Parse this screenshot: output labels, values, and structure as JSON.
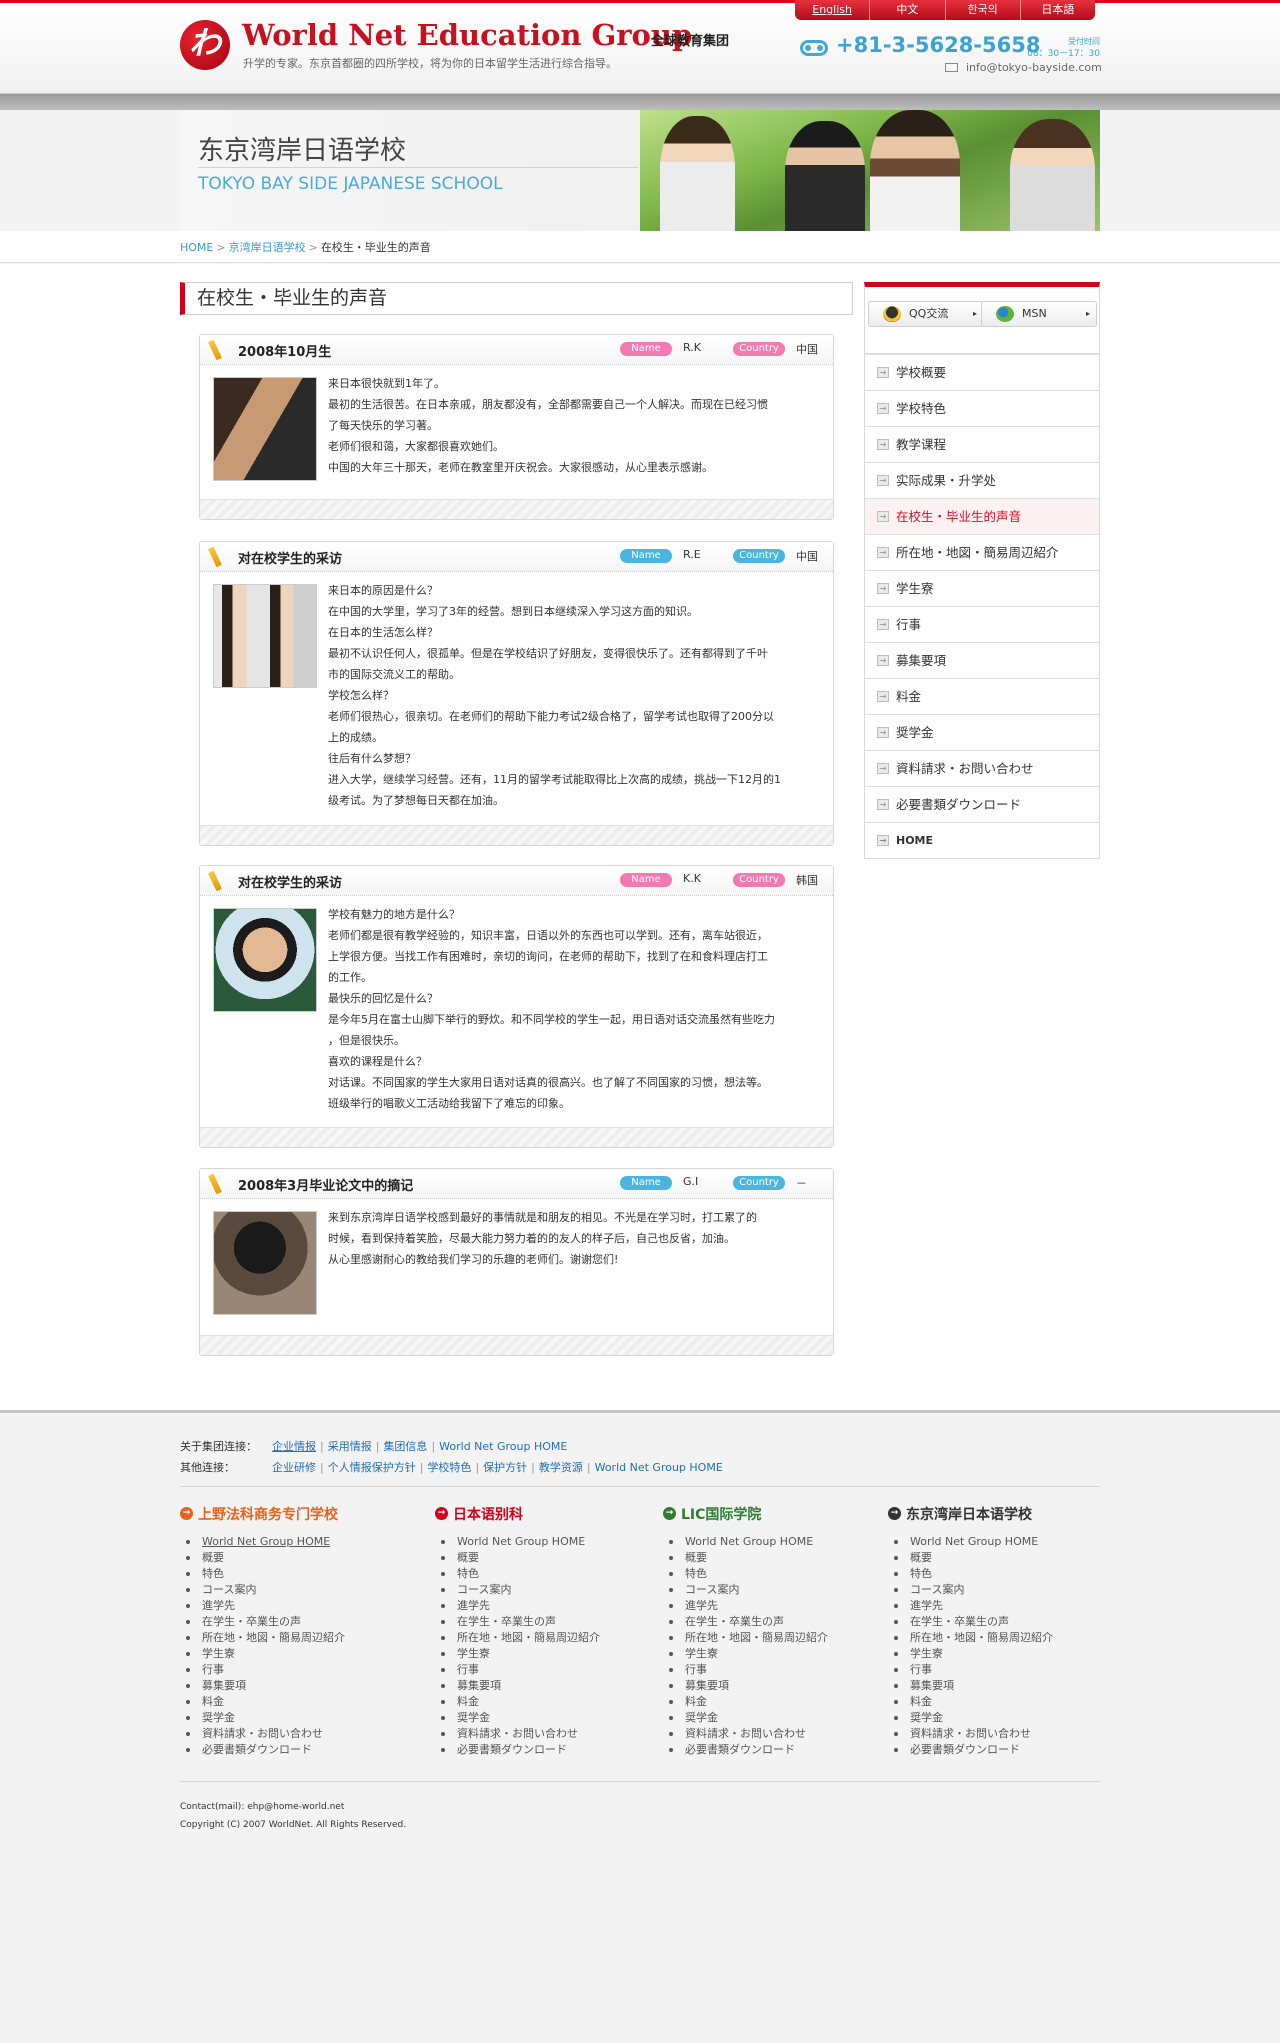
{
  "header": {
    "logo_mark": "わ",
    "title": "World Net Education Group",
    "title_cn": "全球教育集团",
    "subtitle": "升学的专家。东京首都圈的四所学校，将为你的日本留学生活进行综合指导。",
    "languages": [
      "English",
      "中文",
      "한국의",
      "日本語"
    ],
    "phone": "+81-3-5628-5658",
    "hours_label": "受付时间",
    "hours": "08：30－17：30",
    "email": "info@tokyo-bayside.com"
  },
  "banner": {
    "title_cn": "东京湾岸日语学校",
    "title_en": "TOKYO BAY SIDE JAPANESE SCHOOL"
  },
  "breadcrumb": {
    "items": [
      "HOME",
      "京湾岸日语学校"
    ],
    "current": "在校生・毕业生的声音",
    "separator": ">"
  },
  "page_title": "在校生・毕业生的声音",
  "labels": {
    "name": "Name",
    "country": "Country"
  },
  "colors": {
    "accent": "#d4001b",
    "blue_tag": "#4ab6e0",
    "pink_tag": "#f27ab1",
    "link": "#3a9ad5"
  },
  "cards": [
    {
      "title": "2008年10月生",
      "name": "R.K",
      "country": "中国",
      "tag_style": "pink",
      "lines": [
        "来日本很快就到1年了。",
        "最初的生活很苦。在日本亲戚，朋友都没有，全部都需要自己一个人解决。而现在已经习惯",
        "了每天快乐的学习著。",
        "老师们很和蔼，大家都很喜欢她们。",
        "中国的大年三十那天，老师在教室里开庆祝会。大家很感动，从心里表示感谢。"
      ]
    },
    {
      "title": "对在校学生的采访",
      "name": "R.E",
      "country": "中国",
      "tag_style": "blue",
      "lines": [
        "来日本的原因是什么？",
        "在中国的大学里，学习了3年的经营。想到日本继续深入学习这方面的知识。",
        "在日本的生活怎么样？",
        "最初不认识任何人，很孤单。但是在学校结识了好朋友，变得很快乐了。还有都得到了千叶",
        "市的国际交流义工的帮助。",
        "学校怎么样？",
        "老师们很热心，很亲切。在老师们的帮助下能力考试2级合格了，留学考试也取得了200分以",
        "上的成绩。",
        "往后有什么梦想？",
        "进入大学，继续学习经营。还有，11月的留学考试能取得比上次高的成绩，挑战一下12月的1",
        "级考试。为了梦想每日天都在加油。"
      ]
    },
    {
      "title": "对在校学生的采访",
      "name": "K.K",
      "country": "韩国",
      "tag_style": "pink",
      "lines": [
        "学校有魅力的地方是什么？",
        "老师们都是很有教学经验的，知识丰富，日语以外的东西也可以学到。还有，离车站很近，",
        "上学很方便。当找工作有困难时，亲切的询问，在老师的帮助下，找到了在和食料理店打工",
        "的工作。",
        "最快乐的回忆是什么？",
        "是今年5月在富士山脚下举行的野炊。和不同学校的学生一起，用日语对话交流虽然有些吃力",
        "，但是很快乐。",
        "喜欢的课程是什么？",
        "对话课。不同国家的学生大家用日语对话真的很高兴。也了解了不同国家的习惯，想法等。",
        "班级举行的唱歌义工活动给我留下了难忘的印象。"
      ]
    },
    {
      "title": "2008年3月毕业论文中的摘记",
      "name": "G.I",
      "country": "－",
      "tag_style": "blue",
      "lines": [
        "来到东京湾岸日语学校感到最好的事情就是和朋友的相见。不光是在学习时，打工累了的",
        "时候，看到保持着笑脸，尽最大能力努力着的的友人的样子后，自己也反省，加油。",
        "从心里感谢耐心的教给我们学习的乐趣的老师们。谢谢您们!"
      ]
    }
  ],
  "sidebar": {
    "chat": [
      {
        "label": "QQ交流",
        "icon": "qq-icon"
      },
      {
        "label": "MSN",
        "icon": "msn-icon"
      }
    ],
    "arrow_glyph": "▸",
    "item_glyph": "→",
    "items": [
      "学校概要",
      "学校特色",
      "教学课程",
      "实际成果・升学处",
      "在校生・毕业生的声音",
      "所在地・地図・簡易周辺紹介",
      "学生寮",
      "行事",
      "募集要項",
      "料金",
      "奨学金",
      "資料請求・お問い合わせ",
      "必要書類ダウンロード",
      "HOME"
    ],
    "active_index": 4
  },
  "footer": {
    "group_links_label": "关于集团连接：",
    "group_links": [
      "企业情报",
      "采用情报",
      "集团信息",
      "World Net Group HOME"
    ],
    "other_links_label": "其他连接：",
    "other_links": [
      "企业研修",
      "个人情报保护方针",
      "学校特色",
      "保护方针",
      "教学资源",
      "World Net Group HOME"
    ],
    "columns": [
      {
        "title": "上野法科商务专门学校",
        "color": "#e8621a",
        "icon_glyph": "→"
      },
      {
        "title": "日本语别科",
        "color": "#d4001b",
        "icon_glyph": "→"
      },
      {
        "title": "LIC国际学院",
        "color": "#2e7d32",
        "icon_glyph": "→"
      },
      {
        "title": "东京湾岸日本语学校",
        "color": "#333333",
        "icon_glyph": "→"
      }
    ],
    "column_items": [
      "World Net Group HOME",
      "概要",
      "特色",
      "コース案内",
      "進学先",
      "在学生・卒業生の声",
      "所在地・地図・簡易周辺紹介",
      "学生寮",
      "行事",
      "募集要項",
      "料金",
      "奨学金",
      "資料請求・お問い合わせ",
      "必要書類ダウンロード"
    ],
    "contact": "Contact(mail): ehp@home-world.net",
    "copyright": "Copyright (C) 2007 WorldNet. All Rights Reserved."
  }
}
